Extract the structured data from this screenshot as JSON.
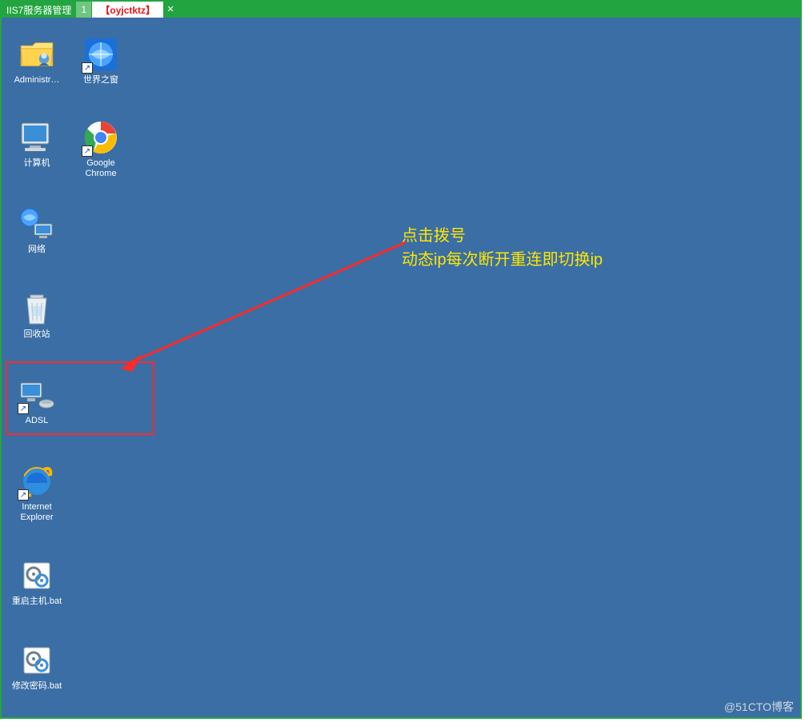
{
  "header": {
    "app_title": "IIS7服务器管理",
    "tab_badge": "1",
    "tab_label": "【oyjctktz】",
    "tab_close": "✕"
  },
  "desktop": {
    "icons": {
      "admin": {
        "label": "Administr…"
      },
      "world": {
        "label": "世界之窗"
      },
      "computer": {
        "label": "计算机"
      },
      "chrome": {
        "label": "Google\nChrome"
      },
      "network": {
        "label": "网络"
      },
      "recycle": {
        "label": "回收站"
      },
      "adsl": {
        "label": "ADSL"
      },
      "ie": {
        "label": "Internet\nExplorer"
      },
      "restart": {
        "label": "重启主机.bat"
      },
      "passwd": {
        "label": "修改密码.bat"
      }
    }
  },
  "annotation": {
    "line1": "点击拨号",
    "line2": "动态ip每次断开重连即切换ip"
  },
  "watermark": "@51CTO博客",
  "colors": {
    "accent_green": "#22a540",
    "desktop_bg": "#3a6ea5",
    "highlight_red": "#ff2a2a",
    "annotation_yellow": "#ffe600"
  }
}
